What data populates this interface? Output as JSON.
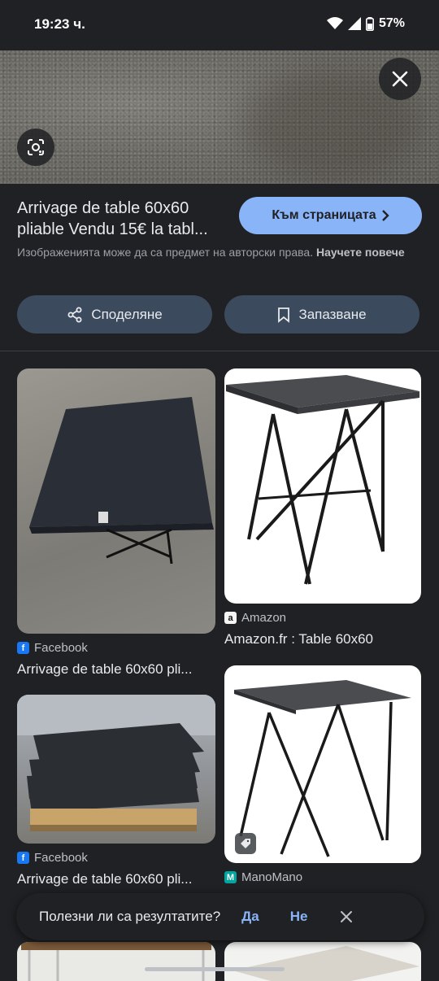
{
  "status_bar": {
    "time": "19:23 ч.",
    "battery": "57%"
  },
  "hero": {
    "close_icon": "close-icon",
    "lens_icon": "lens-icon"
  },
  "result": {
    "title": "Arrivage de table 60x60 pliable Vendu 15€ la tabl...",
    "visit_label": "Към страницата",
    "copyright_text": "Изображенията може да са предмет на авторски права.",
    "copyright_link": "Научете повече",
    "share_label": "Споделяне",
    "save_label": "Запазване"
  },
  "cards": [
    {
      "source": "Facebook",
      "title": "Arrivage de table 60x60 pli..."
    },
    {
      "source": "Amazon",
      "title": "Amazon.fr : Table 60x60"
    },
    {
      "source": "Facebook",
      "title": "Arrivage de table 60x60 pli..."
    },
    {
      "source": "ManoMano",
      "title": ""
    }
  ],
  "feedback": {
    "question": "Полезни ли са резултатите?",
    "yes": "Да",
    "no": "Не"
  },
  "colors": {
    "accent": "#8ab4f8",
    "background": "#202124",
    "button": "#3c4a5e"
  }
}
